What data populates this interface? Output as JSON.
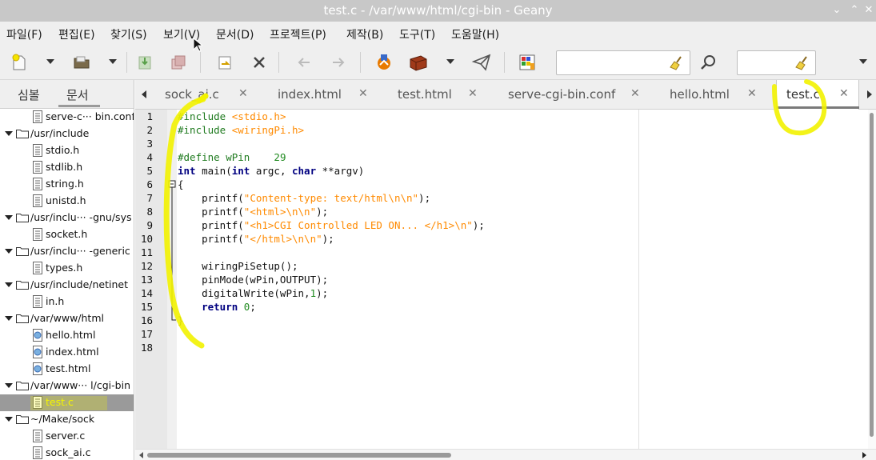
{
  "window": {
    "title": "test.c - /var/www/html/cgi-bin - Geany",
    "controls": [
      "⌄",
      "⌃",
      "✕"
    ]
  },
  "menu": [
    "파일(F)",
    "편집(E)",
    "찾기(S)",
    "보기(V)",
    "문서(D)",
    "프로젝트(P)",
    "제작(B)",
    "도구(T)",
    "도움말(H)"
  ],
  "toolbar": {
    "icons": [
      "new-file-icon",
      "open-folder-icon",
      "save-icon",
      "save-all-icon",
      "revert-icon",
      "close-icon",
      "back-icon",
      "forward-icon",
      "compile-icon",
      "build-icon",
      "send-icon",
      "color-chooser-icon",
      "search-icon",
      "clear-icon"
    ],
    "search_value": "",
    "goto_value": ""
  },
  "sidebar": {
    "tabs": [
      "심볼",
      "문서"
    ],
    "active_tab": "문서",
    "tree": [
      {
        "type": "file",
        "label": "serve-c··· bin.conf",
        "icon": "text-file-icon"
      },
      {
        "type": "dir",
        "label": "/usr/include"
      },
      {
        "type": "file",
        "label": "stdio.h",
        "icon": "text-file-icon"
      },
      {
        "type": "file",
        "label": "stdlib.h",
        "icon": "text-file-icon"
      },
      {
        "type": "file",
        "label": "string.h",
        "icon": "text-file-icon"
      },
      {
        "type": "file",
        "label": "unistd.h",
        "icon": "text-file-icon"
      },
      {
        "type": "dir",
        "label": "/usr/inclu··· -gnu/sys"
      },
      {
        "type": "file",
        "label": "socket.h",
        "icon": "text-file-icon"
      },
      {
        "type": "dir",
        "label": "/usr/inclu··· -generic"
      },
      {
        "type": "file",
        "label": "types.h",
        "icon": "text-file-icon"
      },
      {
        "type": "dir",
        "label": "/usr/include/netinet"
      },
      {
        "type": "file",
        "label": "in.h",
        "icon": "text-file-icon"
      },
      {
        "type": "dir",
        "label": "/var/www/html"
      },
      {
        "type": "file",
        "label": "hello.html",
        "icon": "html-file-icon"
      },
      {
        "type": "file",
        "label": "index.html",
        "icon": "html-file-icon"
      },
      {
        "type": "file",
        "label": "test.html",
        "icon": "html-file-icon"
      },
      {
        "type": "dir",
        "label": "/var/www··· l/cgi-bin"
      },
      {
        "type": "file",
        "label": "test.c",
        "icon": "c-file-icon",
        "selected": true
      },
      {
        "type": "dir",
        "label": "~/Make/sock"
      },
      {
        "type": "file",
        "label": "server.c",
        "icon": "text-file-icon"
      },
      {
        "type": "file",
        "label": "sock_ai.c",
        "icon": "text-file-icon"
      }
    ]
  },
  "tabs": [
    {
      "label": "sock_ai.c"
    },
    {
      "label": "index.html"
    },
    {
      "label": "test.html"
    },
    {
      "label": "serve-cgi-bin.conf"
    },
    {
      "label": "hello.html"
    },
    {
      "label": "test.c",
      "active": true
    }
  ],
  "tab_close": "✕",
  "editor": {
    "line_numbers": [
      "1",
      "2",
      "3",
      "4",
      "5",
      "6",
      "7",
      "8",
      "9",
      "10",
      "11",
      "12",
      "13",
      "14",
      "15",
      "16",
      "17",
      "18"
    ],
    "lines": [
      [
        {
          "t": "#include ",
          "c": "pp"
        },
        {
          "t": "<stdio.h>",
          "c": "inc"
        }
      ],
      [
        {
          "t": "#include ",
          "c": "pp"
        },
        {
          "t": "<wiringPi.h>",
          "c": "inc"
        }
      ],
      [],
      [
        {
          "t": "#define wPin    ",
          "c": "pp"
        },
        {
          "t": "29",
          "c": "num"
        }
      ],
      [
        {
          "t": "int",
          "c": "kw"
        },
        {
          "t": " main("
        },
        {
          "t": "int",
          "c": "kw"
        },
        {
          "t": " argc, "
        },
        {
          "t": "char",
          "c": "kw"
        },
        {
          "t": " **argv)"
        }
      ],
      [
        {
          "t": "{"
        }
      ],
      [
        {
          "t": "    printf("
        },
        {
          "t": "\"Content-type: text/html\\n\\n\"",
          "c": "str"
        },
        {
          "t": ");"
        }
      ],
      [
        {
          "t": "    printf("
        },
        {
          "t": "\"<html>\\n\\n\"",
          "c": "str"
        },
        {
          "t": ");"
        }
      ],
      [
        {
          "t": "    printf("
        },
        {
          "t": "\"<h1>CGI Controlled LED ON... </h1>\\n\"",
          "c": "str"
        },
        {
          "t": ");"
        }
      ],
      [
        {
          "t": "    printf("
        },
        {
          "t": "\"</html>\\n\\n\"",
          "c": "str"
        },
        {
          "t": ");"
        }
      ],
      [],
      [
        {
          "t": "    wiringPiSetup();"
        }
      ],
      [
        {
          "t": "    pinMode(wPin,OUTPUT);"
        }
      ],
      [
        {
          "t": "    digitalWrite(wPin,"
        },
        {
          "t": "1",
          "c": "num"
        },
        {
          "t": ");"
        }
      ],
      [
        {
          "t": "    "
        },
        {
          "t": "return",
          "c": "kw"
        },
        {
          "t": " "
        },
        {
          "t": "0",
          "c": "num"
        },
        {
          "t": ";"
        }
      ],
      [
        {
          "t": "}"
        }
      ],
      [],
      []
    ]
  },
  "colors": {
    "annotation": "#f2f200",
    "string": "#ff8a00",
    "preprocessor": "#1e7a1e",
    "keyword": "#000080"
  }
}
